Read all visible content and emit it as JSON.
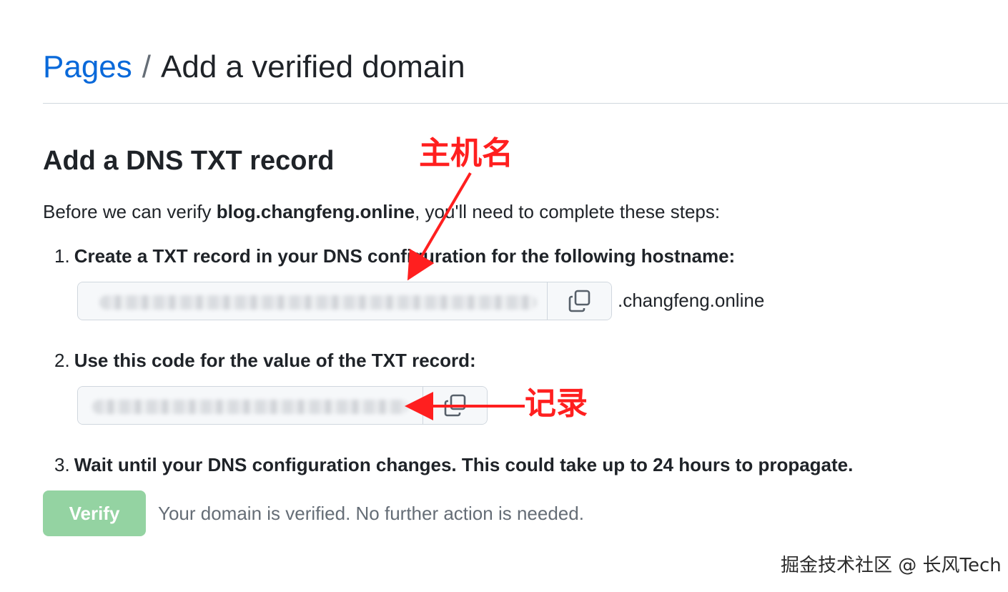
{
  "breadcrumb": {
    "parent": "Pages",
    "separator": "/",
    "current": "Add a verified domain"
  },
  "section": {
    "title": "Add a DNS TXT record",
    "intro_before": "Before we can verify ",
    "domain": "blog.changfeng.online",
    "intro_after": ", you'll need to complete these steps:"
  },
  "steps": [
    {
      "number": "1.",
      "text": "Create a TXT record in your DNS configuration for the following hostname:"
    },
    {
      "number": "2.",
      "text": "Use this code for the value of the TXT record:"
    },
    {
      "number": "3.",
      "text": "Wait until your DNS configuration changes. This could take up to 24 hours to propagate."
    }
  ],
  "hostname": {
    "suffix": ".changfeng.online",
    "copy_icon": "copy-icon"
  },
  "code": {
    "copy_icon": "copy-icon"
  },
  "verify": {
    "button_label": "Verify",
    "status": "Your domain is verified. No further action is needed."
  },
  "annotations": {
    "hostname_label": "主机名",
    "record_label": "记录",
    "color": "#ff1f1f"
  },
  "watermark": "掘金技术社区 @ 长风Tech",
  "colors": {
    "link": "#0969da",
    "verify_button": "#94d3a2",
    "muted_text": "#656d76"
  }
}
